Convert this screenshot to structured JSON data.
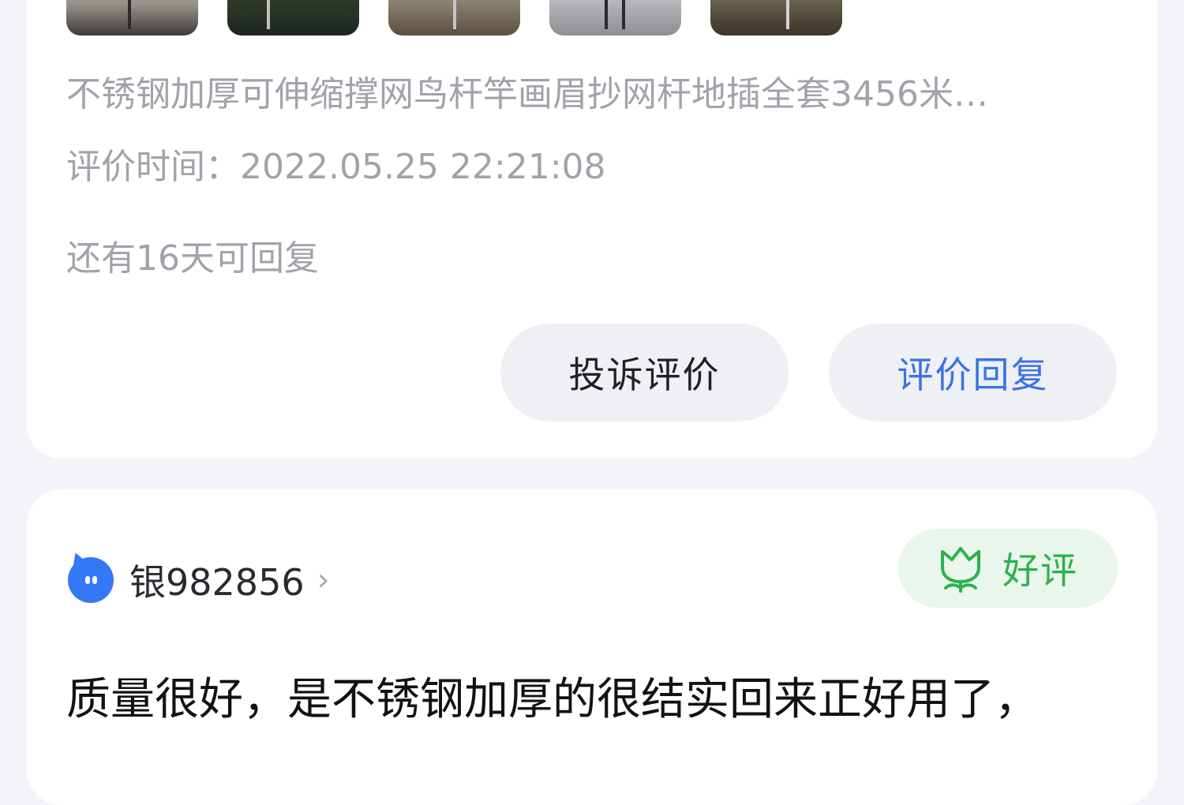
{
  "review_card_1": {
    "product_title": "不锈钢加厚可伸缩撑网鸟杆竿画眉抄网杆地插全套3456米…",
    "review_time": "评价时间：2022.05.25 22:21:08",
    "reply_remaining": "还有16天可回复",
    "complain_button": "投诉评价",
    "reply_button": "评价回复"
  },
  "review_card_2": {
    "username": "银982856",
    "chevron": "›",
    "rating_badge": "好评",
    "review_text": "质量很好，是不锈钢加厚的很结实回来正好用了，"
  },
  "colors": {
    "page_bg": "#f3f4f8",
    "muted_text": "#a1a3aa",
    "reply_blue": "#3a74e2",
    "good_green": "#2bb24c",
    "avatar_blue": "#3478f6"
  },
  "icons": {
    "avatar": "blue-cat-avatar-icon",
    "rating": "flower-icon",
    "nav": "chevron-right-icon"
  }
}
